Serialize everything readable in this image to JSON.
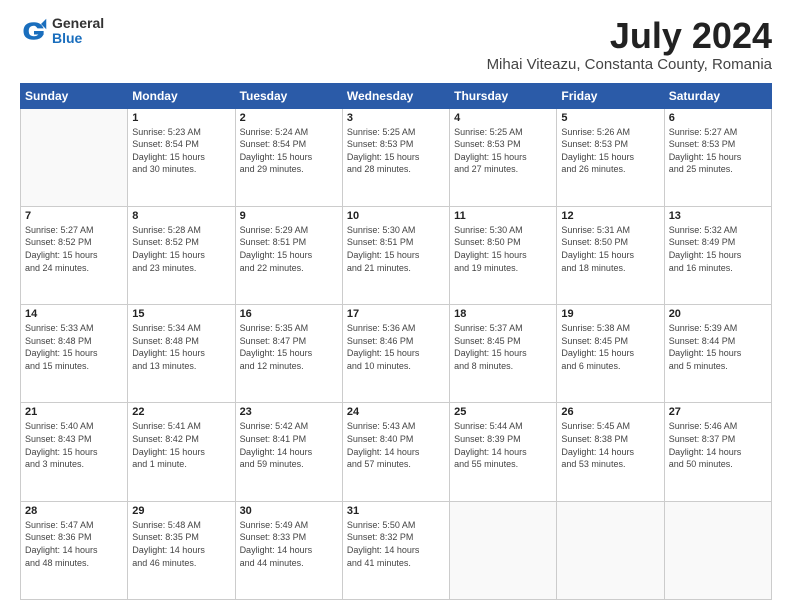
{
  "logo": {
    "general": "General",
    "blue": "Blue"
  },
  "header": {
    "title": "July 2024",
    "subtitle": "Mihai Viteazu, Constanta County, Romania"
  },
  "weekdays": [
    "Sunday",
    "Monday",
    "Tuesday",
    "Wednesday",
    "Thursday",
    "Friday",
    "Saturday"
  ],
  "weeks": [
    [
      {
        "day": "",
        "info": ""
      },
      {
        "day": "1",
        "info": "Sunrise: 5:23 AM\nSunset: 8:54 PM\nDaylight: 15 hours\nand 30 minutes."
      },
      {
        "day": "2",
        "info": "Sunrise: 5:24 AM\nSunset: 8:54 PM\nDaylight: 15 hours\nand 29 minutes."
      },
      {
        "day": "3",
        "info": "Sunrise: 5:25 AM\nSunset: 8:53 PM\nDaylight: 15 hours\nand 28 minutes."
      },
      {
        "day": "4",
        "info": "Sunrise: 5:25 AM\nSunset: 8:53 PM\nDaylight: 15 hours\nand 27 minutes."
      },
      {
        "day": "5",
        "info": "Sunrise: 5:26 AM\nSunset: 8:53 PM\nDaylight: 15 hours\nand 26 minutes."
      },
      {
        "day": "6",
        "info": "Sunrise: 5:27 AM\nSunset: 8:53 PM\nDaylight: 15 hours\nand 25 minutes."
      }
    ],
    [
      {
        "day": "7",
        "info": "Sunrise: 5:27 AM\nSunset: 8:52 PM\nDaylight: 15 hours\nand 24 minutes."
      },
      {
        "day": "8",
        "info": "Sunrise: 5:28 AM\nSunset: 8:52 PM\nDaylight: 15 hours\nand 23 minutes."
      },
      {
        "day": "9",
        "info": "Sunrise: 5:29 AM\nSunset: 8:51 PM\nDaylight: 15 hours\nand 22 minutes."
      },
      {
        "day": "10",
        "info": "Sunrise: 5:30 AM\nSunset: 8:51 PM\nDaylight: 15 hours\nand 21 minutes."
      },
      {
        "day": "11",
        "info": "Sunrise: 5:30 AM\nSunset: 8:50 PM\nDaylight: 15 hours\nand 19 minutes."
      },
      {
        "day": "12",
        "info": "Sunrise: 5:31 AM\nSunset: 8:50 PM\nDaylight: 15 hours\nand 18 minutes."
      },
      {
        "day": "13",
        "info": "Sunrise: 5:32 AM\nSunset: 8:49 PM\nDaylight: 15 hours\nand 16 minutes."
      }
    ],
    [
      {
        "day": "14",
        "info": "Sunrise: 5:33 AM\nSunset: 8:48 PM\nDaylight: 15 hours\nand 15 minutes."
      },
      {
        "day": "15",
        "info": "Sunrise: 5:34 AM\nSunset: 8:48 PM\nDaylight: 15 hours\nand 13 minutes."
      },
      {
        "day": "16",
        "info": "Sunrise: 5:35 AM\nSunset: 8:47 PM\nDaylight: 15 hours\nand 12 minutes."
      },
      {
        "day": "17",
        "info": "Sunrise: 5:36 AM\nSunset: 8:46 PM\nDaylight: 15 hours\nand 10 minutes."
      },
      {
        "day": "18",
        "info": "Sunrise: 5:37 AM\nSunset: 8:45 PM\nDaylight: 15 hours\nand 8 minutes."
      },
      {
        "day": "19",
        "info": "Sunrise: 5:38 AM\nSunset: 8:45 PM\nDaylight: 15 hours\nand 6 minutes."
      },
      {
        "day": "20",
        "info": "Sunrise: 5:39 AM\nSunset: 8:44 PM\nDaylight: 15 hours\nand 5 minutes."
      }
    ],
    [
      {
        "day": "21",
        "info": "Sunrise: 5:40 AM\nSunset: 8:43 PM\nDaylight: 15 hours\nand 3 minutes."
      },
      {
        "day": "22",
        "info": "Sunrise: 5:41 AM\nSunset: 8:42 PM\nDaylight: 15 hours\nand 1 minute."
      },
      {
        "day": "23",
        "info": "Sunrise: 5:42 AM\nSunset: 8:41 PM\nDaylight: 14 hours\nand 59 minutes."
      },
      {
        "day": "24",
        "info": "Sunrise: 5:43 AM\nSunset: 8:40 PM\nDaylight: 14 hours\nand 57 minutes."
      },
      {
        "day": "25",
        "info": "Sunrise: 5:44 AM\nSunset: 8:39 PM\nDaylight: 14 hours\nand 55 minutes."
      },
      {
        "day": "26",
        "info": "Sunrise: 5:45 AM\nSunset: 8:38 PM\nDaylight: 14 hours\nand 53 minutes."
      },
      {
        "day": "27",
        "info": "Sunrise: 5:46 AM\nSunset: 8:37 PM\nDaylight: 14 hours\nand 50 minutes."
      }
    ],
    [
      {
        "day": "28",
        "info": "Sunrise: 5:47 AM\nSunset: 8:36 PM\nDaylight: 14 hours\nand 48 minutes."
      },
      {
        "day": "29",
        "info": "Sunrise: 5:48 AM\nSunset: 8:35 PM\nDaylight: 14 hours\nand 46 minutes."
      },
      {
        "day": "30",
        "info": "Sunrise: 5:49 AM\nSunset: 8:33 PM\nDaylight: 14 hours\nand 44 minutes."
      },
      {
        "day": "31",
        "info": "Sunrise: 5:50 AM\nSunset: 8:32 PM\nDaylight: 14 hours\nand 41 minutes."
      },
      {
        "day": "",
        "info": ""
      },
      {
        "day": "",
        "info": ""
      },
      {
        "day": "",
        "info": ""
      }
    ]
  ]
}
